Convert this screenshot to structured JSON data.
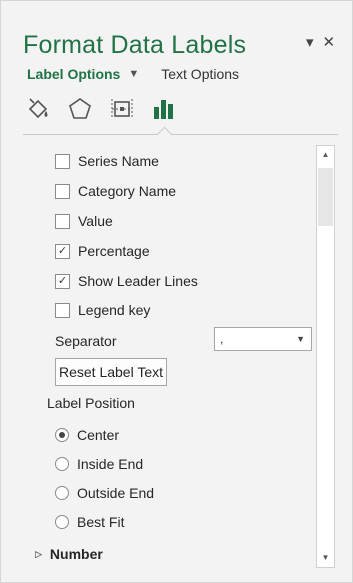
{
  "pane": {
    "title": "Format Data Labels",
    "collapse_icon": "chevron-down-icon",
    "close_icon": "close-icon",
    "colors": {
      "accent": "#217346"
    }
  },
  "tabs": {
    "active_label": "Label Options",
    "other_label": "Text Options"
  },
  "category_icons": [
    "fill-line-icon",
    "effects-icon",
    "size-properties-icon",
    "label-options-icon"
  ],
  "options": {
    "series_name": {
      "label": "Series Name",
      "checked": false
    },
    "category_name": {
      "label": "Category Name",
      "checked": false
    },
    "value": {
      "label": "Value",
      "checked": false
    },
    "percentage": {
      "label": "Percentage",
      "checked": true
    },
    "leader_lines": {
      "label": "Show Leader Lines",
      "checked": true
    },
    "legend_key": {
      "label": "Legend key",
      "checked": false
    },
    "separator_label": "Separator",
    "separator_value": ",",
    "reset_label": "Reset Label Text",
    "label_position_title": "Label Position",
    "positions": [
      {
        "label": "Center",
        "selected": true
      },
      {
        "label": "Inside End",
        "selected": false
      },
      {
        "label": "Outside End",
        "selected": false
      },
      {
        "label": "Best Fit",
        "selected": false
      }
    ]
  },
  "sections": {
    "number": "Number"
  }
}
